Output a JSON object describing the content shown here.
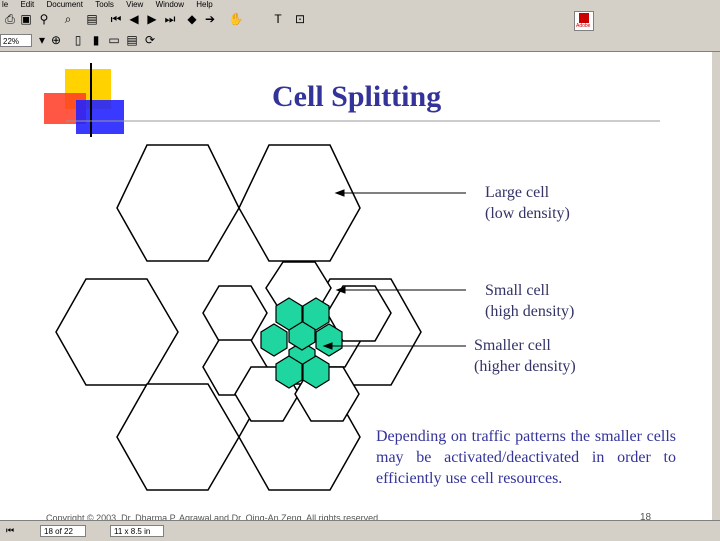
{
  "menu": [
    "le",
    "Edit",
    "Document",
    "Tools",
    "View",
    "Window",
    "Help"
  ],
  "zoom_value": "22%",
  "slide": {
    "title": "Cell Splitting",
    "large_cell": [
      "Large cell",
      "(low density)"
    ],
    "small_cell": [
      "Small cell",
      "(high density)"
    ],
    "smaller_cell": [
      "Smaller cell",
      "(higher density)"
    ],
    "description": "Depending on traffic patterns the smaller cells may be activated/deactivated in order to efficiently use cell resources.",
    "footer": "Copyright © 2003, Dr. Dharma P. Agrawal and Dr. Qing-An Zeng. All rights reserved.",
    "page_number": "18"
  },
  "status": {
    "page": "18 of 22",
    "size": "11 x 8.5 in"
  },
  "colors": {
    "title": "#333399",
    "small_cell_fill": "#20d6a0",
    "deco_yellow": "#ffd200",
    "deco_red": "#ff3a22",
    "deco_blue": "#2424ff"
  },
  "icons": [
    "print-icon",
    "save-icon",
    "search-icon",
    "find-icon",
    "page-icon",
    "first-page-icon",
    "prev-page-icon",
    "next-page-icon",
    "last-page-icon",
    "back-icon",
    "forward-icon",
    "hand-icon",
    "text-select-icon",
    "adobe-icon",
    "actual-size-icon",
    "fit-page-icon",
    "fit-width-icon",
    "rotate-icon"
  ]
}
